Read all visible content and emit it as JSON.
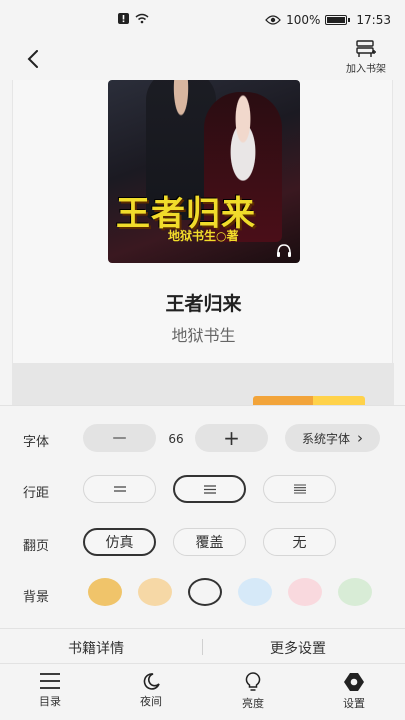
{
  "status_bar": {
    "battery": "100%",
    "time": "17:53"
  },
  "topbar": {
    "add_to_shelf": "加入书架"
  },
  "book": {
    "cover_title": "王者归来",
    "cover_author": "地狱书生○著",
    "title": "王者归来",
    "author": "地狱书生"
  },
  "settings": {
    "font": {
      "label": "字体",
      "decrease": "—",
      "size": "66",
      "increase": "+",
      "family": "系统字体",
      "family_arrow": "›"
    },
    "line_spacing": {
      "label": "行距",
      "selected_index": 1
    },
    "page_turn": {
      "label": "翻页",
      "options": [
        "仿真",
        "覆盖",
        "无"
      ],
      "selected": "仿真"
    },
    "background": {
      "label": "背景",
      "colors": [
        "#f0c46a",
        "#f6d8a6",
        "#f4f4f4",
        "#d6e9f8",
        "#f9d9de",
        "#d8ecd6"
      ],
      "selected_index": 2
    }
  },
  "links": {
    "book_details": "书籍详情",
    "more_settings": "更多设置"
  },
  "bottom_nav": [
    {
      "label": "目录",
      "icon": "menu-icon"
    },
    {
      "label": "夜间",
      "icon": "moon-icon"
    },
    {
      "label": "亮度",
      "icon": "bulb-icon"
    },
    {
      "label": "设置",
      "icon": "gear-icon"
    }
  ]
}
